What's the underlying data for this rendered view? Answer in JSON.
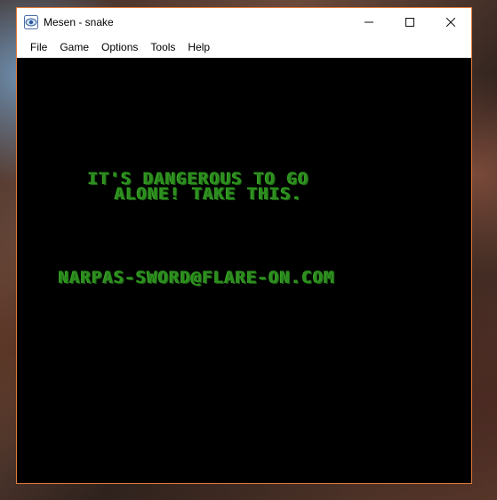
{
  "window": {
    "title": "Mesen - snake",
    "controls": {
      "minimize": "—",
      "maximize": "☐",
      "close": "✕"
    }
  },
  "menu": [
    "File",
    "Game",
    "Options",
    "Tools",
    "Help"
  ],
  "game_screen": {
    "message_line1": "IT'S DANGEROUS TO GO",
    "message_line2": "ALONE! TAKE THIS.",
    "flag": "NARPAS-SWORD@FLARE-ON.COM",
    "text_color": "#2c8e1e",
    "background_color": "#000000"
  },
  "colors": {
    "window_border": "#e07a3a",
    "titlebar_bg": "#ffffff"
  },
  "icons": {
    "app": "mesen-app-icon"
  }
}
